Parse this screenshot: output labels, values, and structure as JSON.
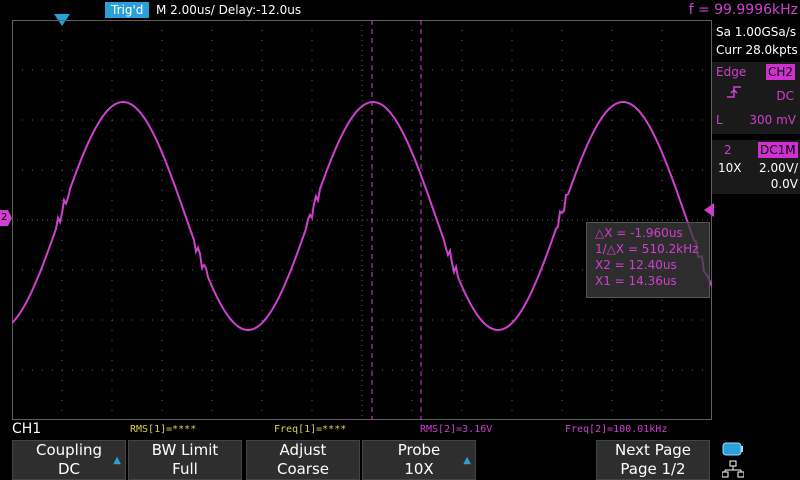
{
  "topbar": {
    "trig_status": "Trig'd",
    "timebase": "M 2.00us/  Delay:-12.0us",
    "frequency": "f = 99.9996kHz"
  },
  "acquisition": {
    "sample_rate": "Sa 1.00GSa/s",
    "memory": "Curr 28.0kpts"
  },
  "trigger": {
    "type": "Edge",
    "source": "CH2",
    "coupling": "DC",
    "level_label": "L",
    "level": "300 mV"
  },
  "channel2": {
    "number": "2",
    "coupling": "DC1M",
    "probe": "10X",
    "scale": "2.00V/",
    "offset": "0.0V"
  },
  "cursors": {
    "dx": "△X = -1.960us",
    "inv_dx": "1/△X = 510.2kHz",
    "x2": "X2 = 12.40us",
    "x1": "X1 = 14.36us"
  },
  "measurements": {
    "channel_label": "CH1",
    "rms1": "RMS[1]=****",
    "freq1": "Freq[1]=****",
    "rms2": "RMS[2]=3.16V",
    "freq2": "Freq[2]=100.01kHz"
  },
  "softkeys": [
    {
      "line1": "Coupling",
      "line2": "DC"
    },
    {
      "line1": "BW Limit",
      "line2": "Full"
    },
    {
      "line1": "Adjust",
      "line2": "Coarse"
    },
    {
      "line1": "Probe",
      "line2": "10X"
    },
    {
      "line1": "Next Page",
      "line2": "Page 1/2"
    }
  ],
  "markers": {
    "channel_marker": "2"
  },
  "colors": {
    "ch2": "#d040d0",
    "accent": "#2a9fd8",
    "grid": "#606060"
  }
}
